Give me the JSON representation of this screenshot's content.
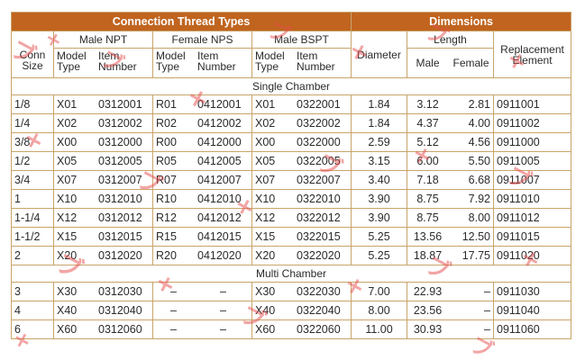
{
  "header": {
    "connection_thread_types": "Connection Thread Types",
    "dimensions": "Dimensions"
  },
  "groups": {
    "conn_size": "Conn Size",
    "male_npt": "Male NPT",
    "female_nps": "Female NPS",
    "male_bspt": "Male BSPT",
    "diameter": "Diameter",
    "length": "Length",
    "replacement_element": "Replacement Element"
  },
  "subheaders": {
    "model_type": "Model Type",
    "item_number": "Item Number",
    "male": "Male",
    "female": "Female"
  },
  "sections": [
    {
      "title": "Single Chamber",
      "rows": [
        [
          "1/8",
          "X01",
          "0312001",
          "R01",
          "0412001",
          "X01",
          "0322001",
          "1.84",
          "3.12",
          "2.81",
          "0911001"
        ],
        [
          "1/4",
          "X02",
          "0312002",
          "R02",
          "0412002",
          "X02",
          "0322002",
          "1.84",
          "4.37",
          "4.00",
          "0911002"
        ],
        [
          "3/8",
          "X00",
          "0312000",
          "R00",
          "0412000",
          "X00",
          "0322000",
          "2.59",
          "5.12",
          "4.56",
          "0911000"
        ],
        [
          "1/2",
          "X05",
          "0312005",
          "R05",
          "0412005",
          "X05",
          "0322005",
          "3.15",
          "6.00",
          "5.50",
          "0911005"
        ],
        [
          "3/4",
          "X07",
          "0312007",
          "R07",
          "0412007",
          "X07",
          "0322007",
          "3.40",
          "7.18",
          "6.68",
          "0911007"
        ],
        [
          "1",
          "X10",
          "0312010",
          "R10",
          "0412010",
          "X10",
          "0322010",
          "3.90",
          "8.75",
          "7.92",
          "0911010"
        ],
        [
          "1-1/4",
          "X12",
          "0312012",
          "R12",
          "0412012",
          "X12",
          "0322012",
          "3.90",
          "8.75",
          "8.00",
          "0911012"
        ],
        [
          "1-1/2",
          "X15",
          "0312015",
          "R15",
          "0412015",
          "X15",
          "0322015",
          "5.25",
          "13.56",
          "12.50",
          "0911015"
        ],
        [
          "2",
          "X20",
          "0312020",
          "R20",
          "0412020",
          "X20",
          "0322020",
          "5.25",
          "18.87",
          "17.75",
          "0911020"
        ]
      ]
    },
    {
      "title": "Multi Chamber",
      "rows": [
        [
          "3",
          "X30",
          "0312030",
          "–",
          "–",
          "X30",
          "0322030",
          "7.00",
          "22.93",
          "–",
          "0911030"
        ],
        [
          "4",
          "X40",
          "0312040",
          "–",
          "–",
          "X40",
          "0322040",
          "8.00",
          "23.56",
          "–",
          "0911040"
        ],
        [
          "6",
          "X60",
          "0312060",
          "–",
          "–",
          "X60",
          "0322060",
          "11.00",
          "30.93",
          "–",
          "0911060"
        ]
      ]
    }
  ]
}
